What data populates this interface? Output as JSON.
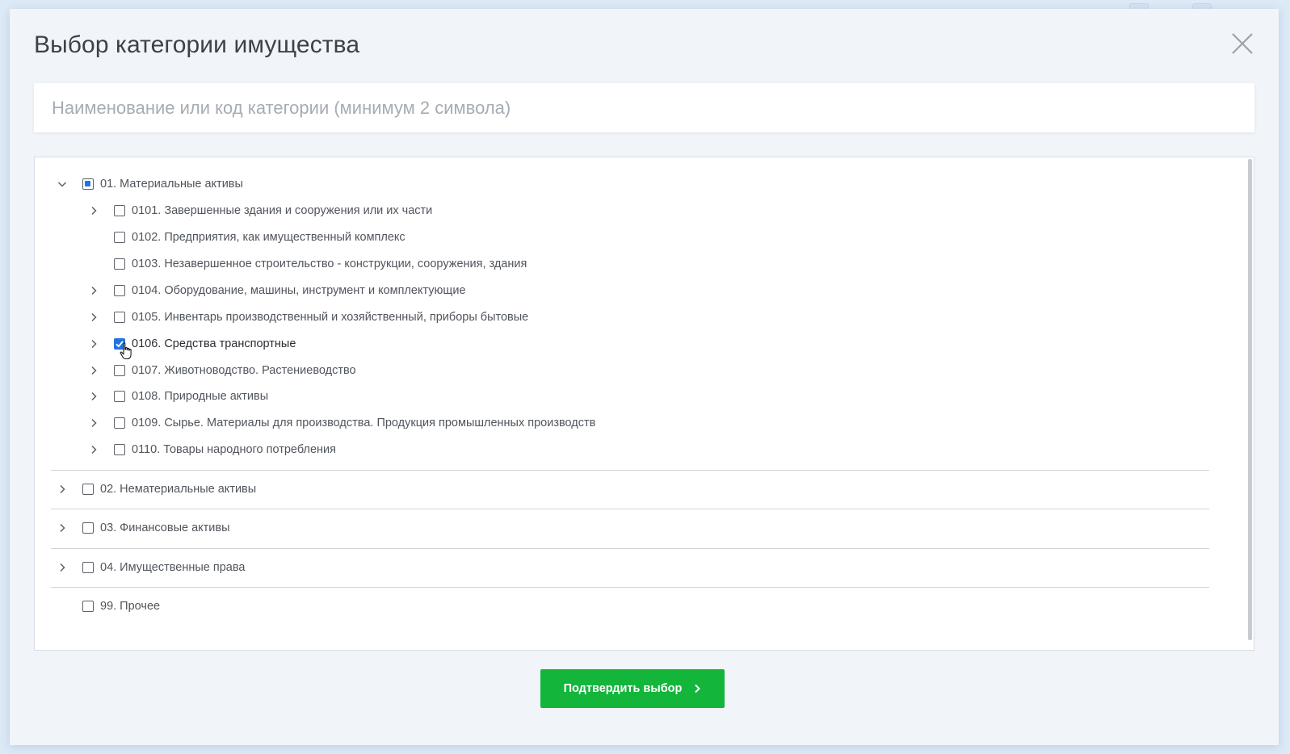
{
  "modal": {
    "title": "Выбор категории имущества"
  },
  "search": {
    "placeholder": "Наименование или код категории (минимум 2 символа)",
    "value": ""
  },
  "tree": {
    "groups": [
      {
        "label": "01. Материальные активы",
        "expanded": true,
        "state": "partial",
        "children": [
          {
            "label": "0101. Завершенные здания и сооружения или их части",
            "has_children": true,
            "checked": false
          },
          {
            "label": "0102. Предприятия, как имущественный комплекс",
            "has_children": false,
            "checked": false
          },
          {
            "label": "0103. Незавершенное строительство - конструкции, сооружения, здания",
            "has_children": false,
            "checked": false
          },
          {
            "label": "0104. Оборудование, машины, инструмент и комплектующие",
            "has_children": true,
            "checked": false
          },
          {
            "label": "0105. Инвентарь производственный и хозяйственный, приборы бытовые",
            "has_children": true,
            "checked": false
          },
          {
            "label": "0106. Средства транспортные",
            "has_children": true,
            "checked": true
          },
          {
            "label": "0107. Животноводство. Растениеводство",
            "has_children": true,
            "checked": false
          },
          {
            "label": "0108. Природные активы",
            "has_children": true,
            "checked": false
          },
          {
            "label": "0109. Сырье. Материалы для производства. Продукция промышленных производств",
            "has_children": true,
            "checked": false
          },
          {
            "label": "0110. Товары народного потребления",
            "has_children": true,
            "checked": false
          }
        ]
      },
      {
        "label": "02. Нематериальные активы",
        "expanded": false,
        "state": "unchecked",
        "has_children": true
      },
      {
        "label": "03. Финансовые активы",
        "expanded": false,
        "state": "unchecked",
        "has_children": true
      },
      {
        "label": "04. Имущественные права",
        "expanded": false,
        "state": "unchecked",
        "has_children": true
      },
      {
        "label": "99. Прочее",
        "expanded": false,
        "state": "unchecked",
        "has_children": false
      }
    ]
  },
  "footer": {
    "confirm_label": "Подтвердить выбор"
  },
  "colors": {
    "accent_blue": "#1f73e6",
    "confirm_green": "#13b53b",
    "backdrop": "#dce9f7"
  },
  "icons": {
    "close": "close-icon",
    "expand": "chevron-right-icon",
    "collapse": "chevron-down-icon",
    "confirm_arrow": "chevron-right-icon",
    "cursor": "hand-pointer-icon"
  }
}
